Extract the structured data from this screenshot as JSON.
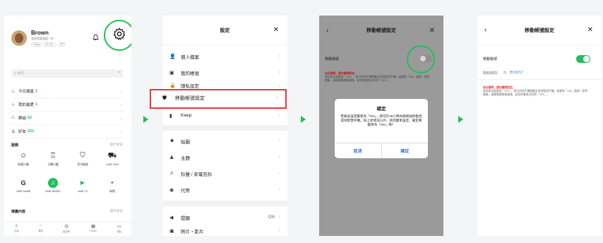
{
  "panel1": {
    "profile_name": "Brown",
    "profile_status": "我就是最喜歡一杯",
    "tags": [
      "Today",
      "JP-VN...",
      "OP"
    ],
    "search_placeholder": "Q 搜尋",
    "friends": [
      {
        "label": "今日壽星",
        "count": "1"
      },
      {
        "label": "我的最愛",
        "count": "1"
      },
      {
        "label": "群組",
        "count": "62"
      },
      {
        "label": "好友",
        "count": "221"
      }
    ],
    "services_title": "服務",
    "services_more": "顯示更多",
    "services": [
      {
        "icon": "☺",
        "label": "貼圖小舖"
      },
      {
        "icon": "♖",
        "label": "主題小舖"
      },
      {
        "icon": "⛉",
        "label": "官方帳號"
      },
      {
        "icon": "⛟",
        "label": "LINE TAXI"
      },
      {
        "icon": "G",
        "label": "LINE GAME"
      },
      {
        "icon": "♫",
        "label": "LINE MUSIC"
      },
      {
        "icon": "▶",
        "label": "LINE TV"
      },
      {
        "icon": "+",
        "label": "新增"
      }
    ],
    "recommend_title": "推薦內容",
    "recommend_more": "顯示更多",
    "tabs": [
      "主頁",
      "聊天",
      "貼文串",
      "TODAY",
      "錢包"
    ]
  },
  "panel2": {
    "title": "設定",
    "rows1": [
      {
        "icon": "👤",
        "label": "個人檔案"
      },
      {
        "icon": "▣",
        "label": "我的帳號"
      },
      {
        "icon": "🔒",
        "label": "隱私設定"
      }
    ],
    "highlight": {
      "icon": "⛊",
      "label": "移動帳號設定"
    },
    "rows2": [
      {
        "icon": "▮",
        "label": "Keep"
      }
    ],
    "rows3": [
      {
        "icon": "☻",
        "label": "貼圖"
      },
      {
        "icon": "♟",
        "label": "主題"
      },
      {
        "icon": "♬",
        "label": "鈴聲 / 來電答鈴"
      },
      {
        "icon": "◉",
        "label": "代幣"
      }
    ],
    "rows4": [
      {
        "icon": "◀",
        "label": "提醒",
        "value": "ON"
      },
      {
        "icon": "▣",
        "label": "照片・影片",
        "value": ""
      }
    ]
  },
  "panel3": {
    "title": "移動帳號設定",
    "toggle_label": "移動帳號",
    "warn_title": "非必要時，請勿變更設定。",
    "warn_body": "將此設定變更為「ON」，即可於新手機移動至其他智慧手機。變更為「ON」超過一定時間後，或確實移動帳號後，設定將會再次回到「OFF」。",
    "dialog_title": "確定",
    "dialog_body": "若將此設定變更為「ON」，即可於36小時內將帳號移動至其他智慧手機。除上述情況以外，請勿變更設定。確定要變更為「ON」嗎？",
    "cancel": "取消",
    "confirm": "確定"
  },
  "panel4": {
    "title": "移動帳號設定",
    "toggle_label": "移動帳號",
    "remaining_label": "剩餘時間：",
    "remaining_time": "35:59:57",
    "warn_title": "非必要時，請勿變更設定。",
    "warn_body": "將此設定變更為「ON」，即可於新手機移動至其他智慧手機。變更為「ON」超過一定時間後，或確實移動帳號後，設定將會再次回到「OFF」。"
  },
  "colors": {
    "accent": "#1fbf5a",
    "highlight": "#e53935",
    "link": "#3b6fd8"
  }
}
